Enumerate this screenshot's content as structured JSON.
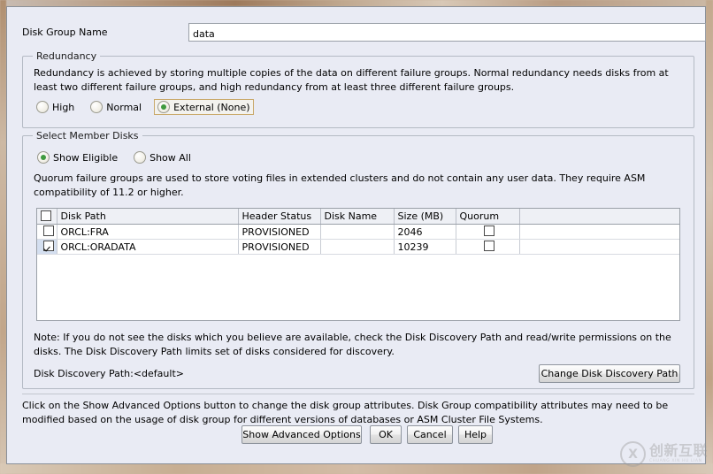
{
  "dialog": {
    "name_field": {
      "label": "Disk Group Name",
      "value": "data",
      "placeholder": ""
    },
    "redundancy": {
      "title": "Redundancy",
      "description": "Redundancy is achieved by storing multiple copies of the data on different failure groups. Normal redundancy needs disks from at least two different failure groups, and high redundancy from at least three different failure groups.",
      "options": [
        {
          "label": "High",
          "selected": false
        },
        {
          "label": "Normal",
          "selected": false
        },
        {
          "label": "External (None)",
          "selected": true,
          "focused": true
        }
      ]
    },
    "member_disks": {
      "title": "Select Member Disks",
      "filter_options": [
        {
          "label": "Show Eligible",
          "selected": true
        },
        {
          "label": "Show All",
          "selected": false
        }
      ],
      "quorum_note": "Quorum failure groups are used to store voting files in extended clusters and do not contain any user data. They require ASM compatibility of 11.2 or higher.",
      "table": {
        "headers": [
          "",
          "Disk Path",
          "Header Status",
          "Disk Name",
          "Size (MB)",
          "Quorum",
          ""
        ],
        "rows": [
          {
            "checked": false,
            "selected": false,
            "disk_path": "ORCL:FRA",
            "header_status": "PROVISIONED",
            "disk_name": "",
            "size_mb": "2046",
            "quorum": false
          },
          {
            "checked": true,
            "selected": true,
            "disk_path": "ORCL:ORADATA",
            "header_status": "PROVISIONED",
            "disk_name": "",
            "size_mb": "10239",
            "quorum": false
          }
        ]
      },
      "note": "Note: If you do not see the disks which you believe are available, check the Disk Discovery Path and read/write permissions on the disks. The Disk Discovery Path limits set of disks considered for discovery.",
      "discovery_path_label": "Disk Discovery Path:<default>",
      "change_discovery_button": "Change Disk Discovery Path"
    },
    "footer": {
      "advanced_note": "Click on the Show Advanced Options button to change the disk group attributes. Disk Group compatibility attributes may need to be modified based on the usage of disk group for different versions of databases or ASM Cluster File Systems.",
      "buttons": [
        {
          "label": "Show Advanced Options"
        },
        {
          "label": "OK"
        },
        {
          "label": "Cancel"
        },
        {
          "label": "Help"
        }
      ]
    }
  },
  "watermark": {
    "mark": "X",
    "name_cn": "创新互联",
    "name_en": "CHUANG XIN HU LIAN"
  },
  "colors": {
    "dialog_bg": "#e9ebf4",
    "accent_focus": "#c9a96b",
    "radio_on": "#3f9a3f",
    "row_selected": "#d4dff0"
  }
}
